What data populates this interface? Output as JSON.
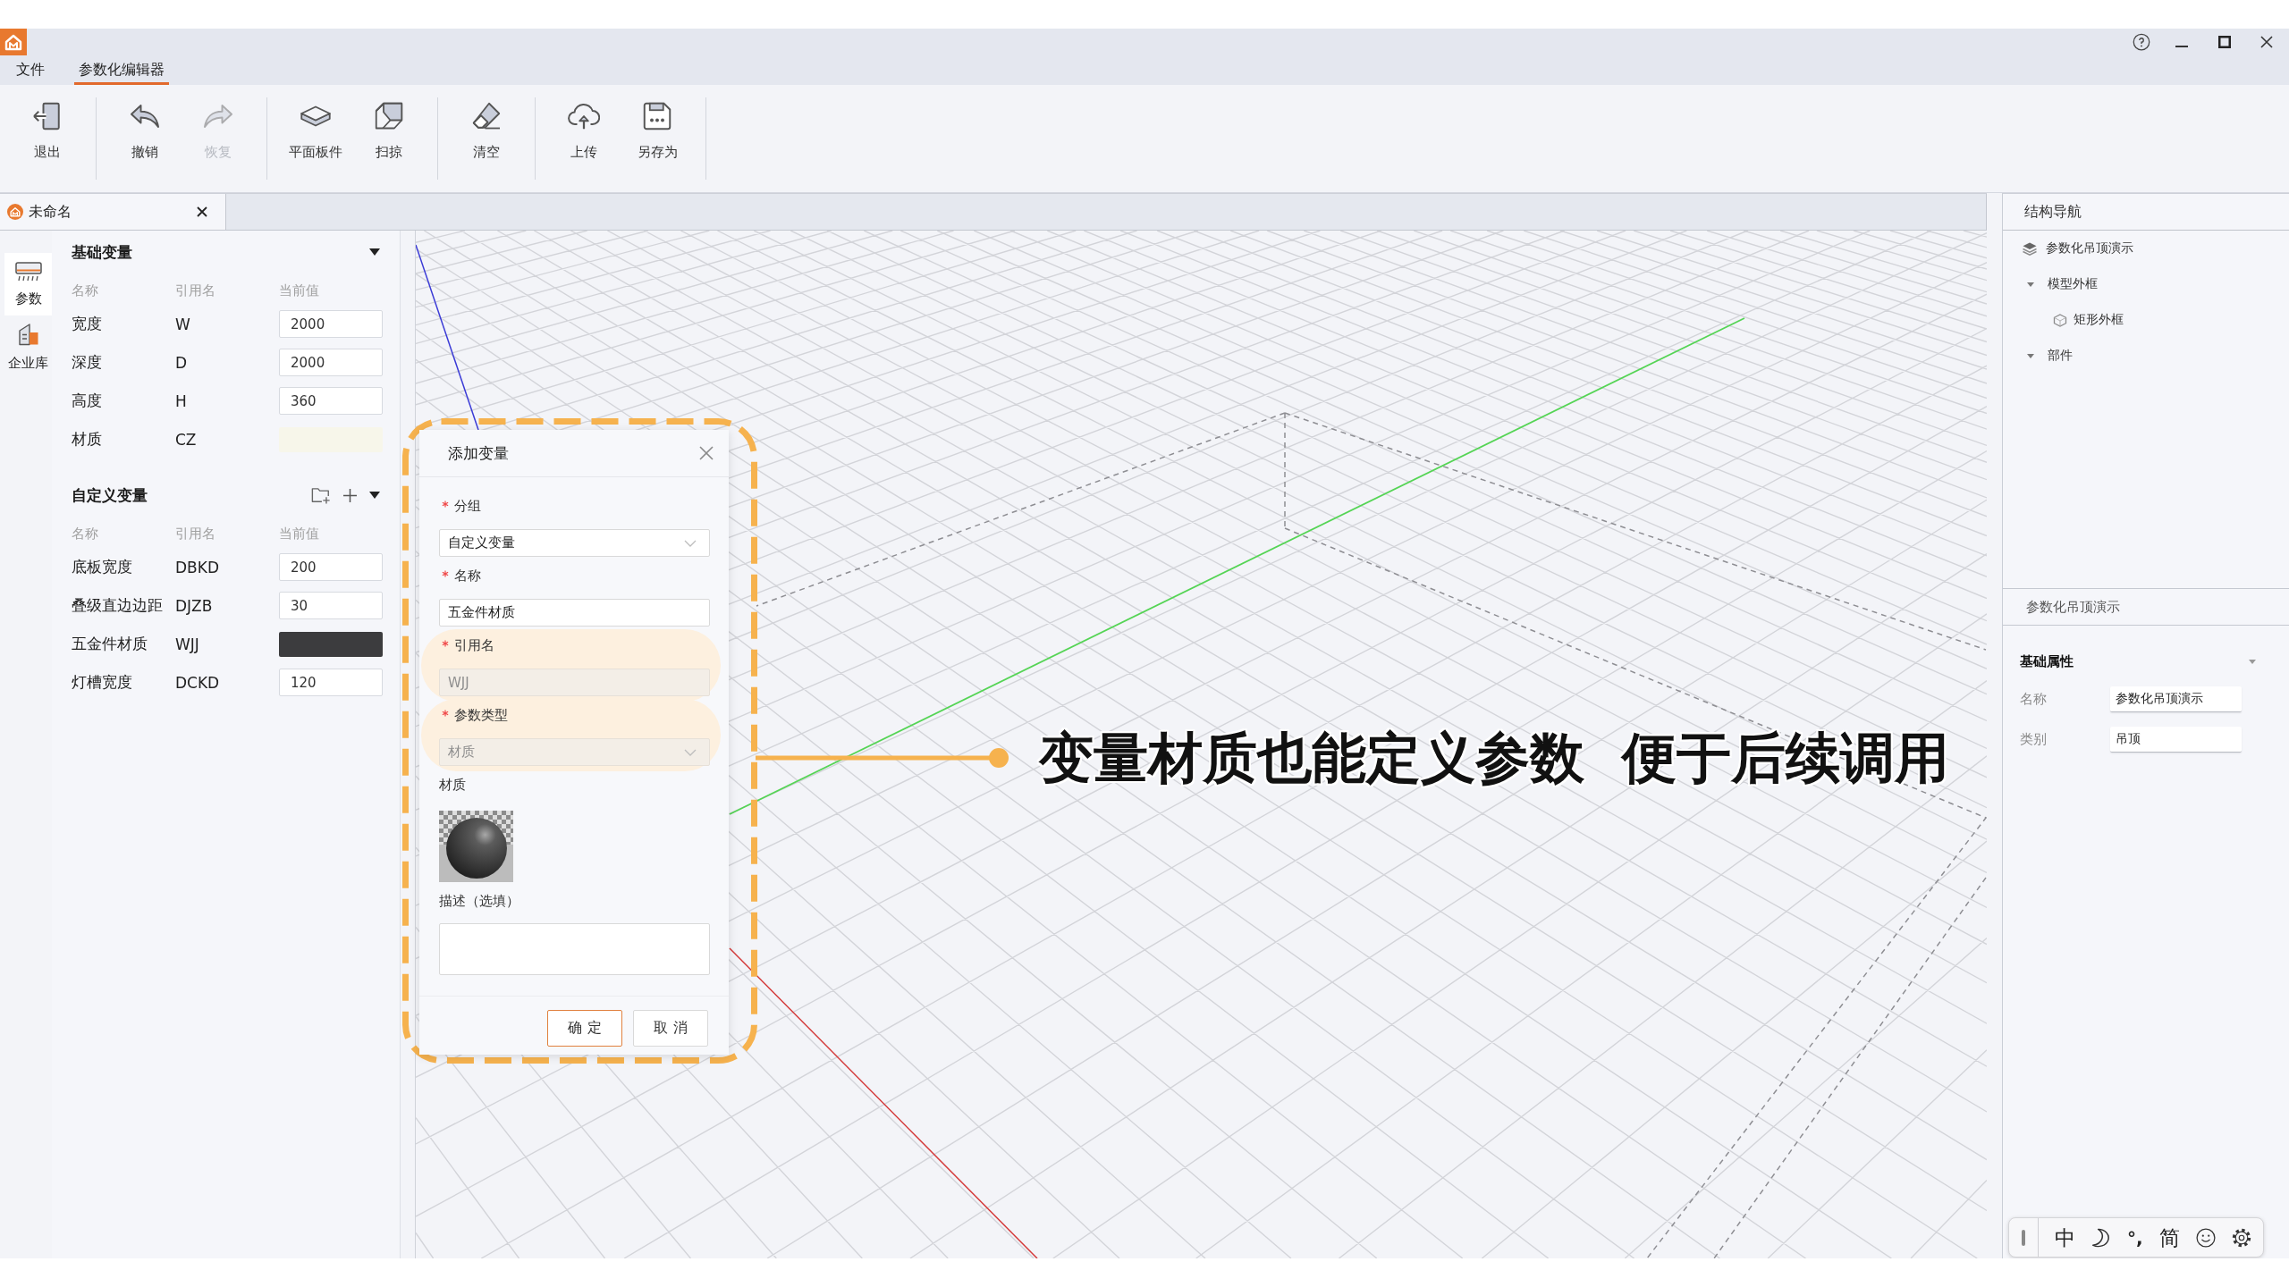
{
  "menu": [
    {
      "label": "文件",
      "selected": false
    },
    {
      "label": "参数化编辑器",
      "selected": true
    }
  ],
  "toolbar": [
    [
      {
        "kind": "exit",
        "label": "退出",
        "disabled": false
      }
    ],
    [
      {
        "kind": "undo",
        "label": "撤销",
        "disabled": false
      },
      {
        "kind": "redo",
        "label": "恢复",
        "disabled": true
      }
    ],
    [
      {
        "kind": "slab",
        "label": "平面板件",
        "disabled": false
      },
      {
        "kind": "sweep",
        "label": "扫掠",
        "disabled": false
      }
    ],
    [
      {
        "kind": "eraser",
        "label": "清空",
        "disabled": false
      }
    ],
    [
      {
        "kind": "upload",
        "label": "上传",
        "disabled": false
      },
      {
        "kind": "save",
        "label": "另存为",
        "disabled": false
      }
    ]
  ],
  "document_tabs": [
    {
      "label": "未命名",
      "selected": true
    }
  ],
  "side_tabs": [
    {
      "kind": "params",
      "label": "参数",
      "selected": true
    },
    {
      "kind": "library",
      "label": "企业库",
      "selected": false
    }
  ],
  "variable_groups": [
    {
      "kind": "basic",
      "title": "基础变量",
      "expanded": true,
      "columns": [
        "名称",
        "引用名",
        "当前值"
      ],
      "rows": [
        {
          "kind": "number",
          "name": "宽度",
          "ref": "W",
          "value": "2000"
        },
        {
          "kind": "number",
          "name": "深度",
          "ref": "D",
          "value": "2000"
        },
        {
          "kind": "number",
          "name": "高度",
          "ref": "H",
          "value": "360"
        },
        {
          "kind": "material",
          "name": "材质",
          "ref": "CZ",
          "color": "#f7f6ea"
        }
      ]
    },
    {
      "kind": "custom",
      "title": "自定义变量",
      "expanded": true,
      "columns": [
        "名称",
        "引用名",
        "当前值"
      ],
      "rows": [
        {
          "kind": "number",
          "name": "底板宽度",
          "ref": "DBKD",
          "value": "200"
        },
        {
          "kind": "number",
          "name": "叠级直边边距",
          "ref": "DJZB",
          "value": "30"
        },
        {
          "kind": "material",
          "name": "五金件材质",
          "ref": "WJJ",
          "color": "#3c3c3e"
        },
        {
          "kind": "number",
          "name": "灯槽宽度",
          "ref": "DCKD",
          "value": "120"
        }
      ]
    }
  ],
  "dialog": {
    "title": "添加变量",
    "fields": [
      {
        "kind": "select",
        "label": "分组",
        "required": true,
        "value": "自定义变量",
        "disabled": false,
        "highlighted": false
      },
      {
        "kind": "text",
        "label": "名称",
        "required": true,
        "value": "五金件材质",
        "disabled": false,
        "highlighted": false
      },
      {
        "kind": "text",
        "label": "引用名",
        "required": true,
        "value": "WJJ",
        "disabled": true,
        "highlighted": true
      },
      {
        "kind": "select",
        "label": "参数类型",
        "required": true,
        "value": "材质",
        "disabled": true,
        "highlighted": true
      },
      {
        "kind": "material",
        "label": "材质",
        "required": false,
        "highlighted": false
      },
      {
        "kind": "textarea",
        "label": "描述（选填）",
        "required": false,
        "disabled": false,
        "highlighted": false
      }
    ],
    "buttons": [
      {
        "label": "确 定",
        "primary": true
      },
      {
        "label": "取 消",
        "primary": false
      }
    ]
  },
  "callout": {
    "texts": [
      "变量材质也能定义参数",
      "便于后续调用"
    ]
  },
  "structure_nav": {
    "title": "结构导航",
    "items": [
      {
        "kind": "model",
        "label": "参数化吊顶演示"
      },
      {
        "kind": "group",
        "label": "模型外框",
        "expanded": true,
        "children": [
          {
            "kind": "shape",
            "label": "矩形外框"
          }
        ]
      },
      {
        "kind": "group",
        "label": "部件",
        "expanded": true
      }
    ]
  },
  "properties": {
    "title": "参数化吊顶演示",
    "section": {
      "title": "基础属性",
      "expanded": true,
      "fields": [
        {
          "label": "名称",
          "value": "参数化吊顶演示"
        },
        {
          "label": "类别",
          "value": "吊顶"
        }
      ]
    }
  },
  "ime_bar": {
    "mode": "中",
    "punctuation": "°,",
    "charset": "简"
  }
}
